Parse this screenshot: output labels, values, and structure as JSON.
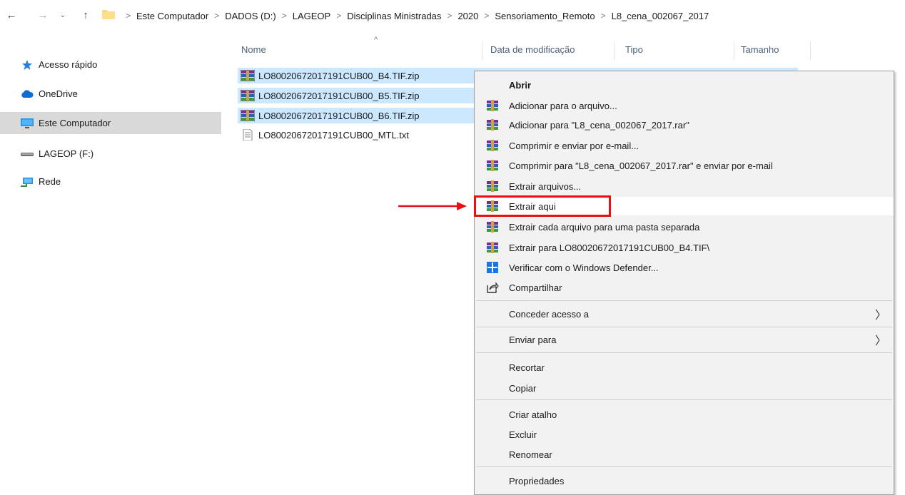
{
  "addressbar": {
    "back_icon": "arrow-left-icon",
    "forward_icon": "arrow-right-icon",
    "recent_icon": "chevron-down-icon",
    "up_icon": "arrow-up-icon",
    "breadcrumbs": [
      "Este Computador",
      "DADOS (D:)",
      "LAGEOP",
      "Disciplinas Ministradas",
      "2020",
      "Sensoriamento_Remoto",
      "L8_cena_002067_2017"
    ]
  },
  "navpane": {
    "items": [
      {
        "label": "Acesso rápido",
        "icon": "star-icon"
      },
      {
        "label": "OneDrive",
        "icon": "cloud-icon"
      },
      {
        "label": "Este Computador",
        "icon": "monitor-icon",
        "selected": true
      },
      {
        "label": "LAGEOP (F:)",
        "icon": "drive-icon"
      },
      {
        "label": "Rede",
        "icon": "network-icon"
      }
    ]
  },
  "columns": {
    "name": "Nome",
    "modified": "Data de modificação",
    "type": "Tipo",
    "size": "Tamanho"
  },
  "files": [
    {
      "name": "LO80020672017191CUB00_B4.TIF.zip",
      "icon": "winrar-archive-icon",
      "selected": true
    },
    {
      "name": "LO80020672017191CUB00_B5.TIF.zip",
      "icon": "winrar-archive-icon",
      "selected": true
    },
    {
      "name": "LO80020672017191CUB00_B6.TIF.zip",
      "icon": "winrar-archive-icon",
      "selected": true
    },
    {
      "name": "LO80020672017191CUB00_MTL.txt",
      "icon": "text-file-icon",
      "selected": false
    }
  ],
  "context_menu": {
    "open": "Abrir",
    "add_to_archive": "Adicionar para o arquivo...",
    "add_to_rar": "Adicionar para \"L8_cena_002067_2017.rar\"",
    "compress_email": "Comprimir e enviar por e-mail...",
    "compress_rar_email": "Comprimir para \"L8_cena_002067_2017.rar\" e enviar por e-mail",
    "extract_files": "Extrair arquivos...",
    "extract_here": "Extrair aqui",
    "extract_each": "Extrair cada arquivo para uma pasta separada",
    "extract_to": "Extrair para LO80020672017191CUB00_B4.TIF\\",
    "defender": "Verificar com o Windows Defender...",
    "share": "Compartilhar",
    "give_access": "Conceder acesso a",
    "send_to": "Enviar para",
    "cut": "Recortar",
    "copy": "Copiar",
    "create_shortcut": "Criar atalho",
    "delete": "Excluir",
    "rename": "Renomear",
    "properties": "Propriedades",
    "submenu_arrow": "〉"
  },
  "colors": {
    "selection": "#cce8ff",
    "menu_background": "#f2f2f2",
    "highlight_box": "#e81010"
  }
}
